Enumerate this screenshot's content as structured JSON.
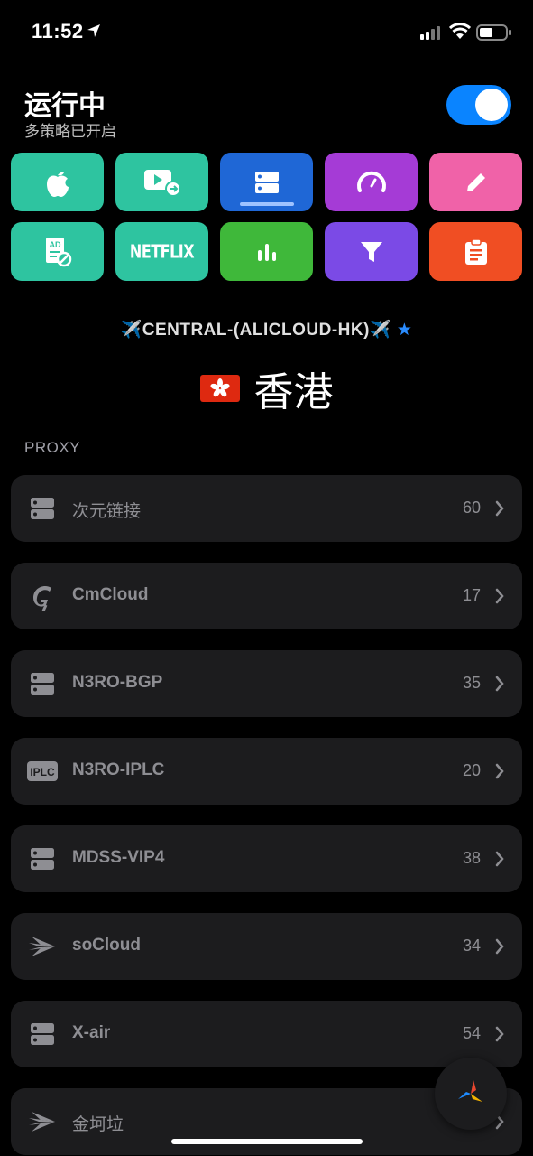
{
  "status_bar": {
    "time": "11:52"
  },
  "header": {
    "title": "运行中",
    "subtitle": "多策略已开启",
    "toggle_on": true
  },
  "tiles": [
    {
      "icon": "apple-icon",
      "color": "#2ec4a0"
    },
    {
      "icon": "video-play-icon",
      "color": "#2ec4a0"
    },
    {
      "icon": "server-icon",
      "color": "#1f67d6",
      "selected": true
    },
    {
      "icon": "speedometer-icon",
      "color": "#a53bd6"
    },
    {
      "icon": "pencil-icon",
      "color": "#f062a8"
    },
    {
      "icon": "ad-block-icon",
      "color": "#2ec4a0"
    },
    {
      "icon": "netflix-icon",
      "label": "NETFLIX",
      "color": "#2ec4a0"
    },
    {
      "icon": "bar-chart-icon",
      "color": "#3fb83a"
    },
    {
      "icon": "filter-icon",
      "color": "#7b4ae6"
    },
    {
      "icon": "clipboard-icon",
      "color": "#f04e23"
    }
  ],
  "current": {
    "policy": "✈️CENTRAL-(ALICLOUD-HK)✈️",
    "star": "★",
    "region": "香港"
  },
  "section_label": "PROXY",
  "proxies": [
    {
      "icon": "server-icon",
      "name": "次元链接",
      "count": "60"
    },
    {
      "icon": "cmcloud-logo-icon",
      "name": "CmCloud",
      "count": "17"
    },
    {
      "icon": "server-icon",
      "name": "N3RO-BGP",
      "count": "35"
    },
    {
      "icon": "iplc-badge-icon",
      "badge": "IPLC",
      "name": "N3RO-IPLC",
      "count": "20"
    },
    {
      "icon": "server-icon",
      "name": "MDSS-VIP4",
      "count": "38"
    },
    {
      "icon": "socloud-logo-icon",
      "name": "soCloud",
      "count": "34"
    },
    {
      "icon": "server-icon",
      "name": "X-air",
      "count": "54"
    },
    {
      "icon": "socloud-logo-icon",
      "name": "金坷垃",
      "count": ""
    }
  ]
}
